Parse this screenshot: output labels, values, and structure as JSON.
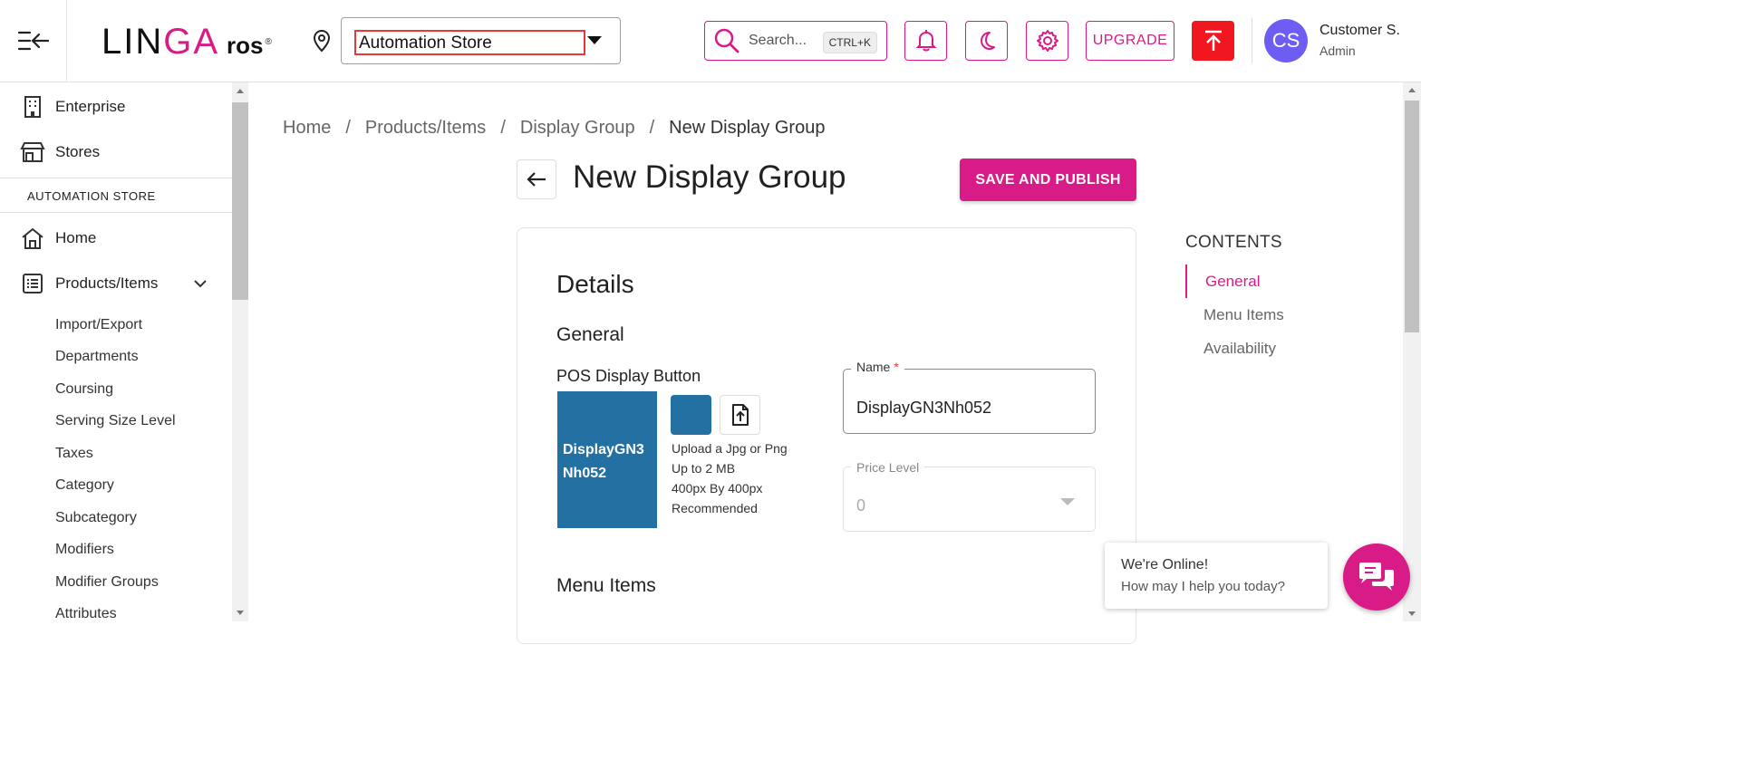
{
  "header": {
    "logo_linga_part1": "LIN",
    "logo_linga_part2": "GA",
    "logo_ros": "ros",
    "logo_reg": "®",
    "store_selected": "Automation Store",
    "search_placeholder": "Search...",
    "search_shortcut": "CTRL+K",
    "upgrade_label": "UPGRADE",
    "user_initials": "CS",
    "user_name": "Customer S.",
    "user_role": "Admin",
    "accent_color": "#d81b87"
  },
  "sidebar": {
    "top_items": [
      {
        "label": "Enterprise",
        "icon": "building-icon"
      },
      {
        "label": "Stores",
        "icon": "store-icon"
      }
    ],
    "section_title": "AUTOMATION STORE",
    "items": [
      {
        "label": "Home",
        "icon": "home-icon"
      },
      {
        "label": "Products/Items",
        "icon": "list-icon"
      }
    ],
    "sub_items": [
      "Import/Export",
      "Departments",
      "Coursing",
      "Serving Size Level",
      "Taxes",
      "Category",
      "Subcategory",
      "Modifiers",
      "Modifier Groups",
      "Attributes"
    ]
  },
  "breadcrumb": {
    "items": [
      "Home",
      "Products/Items",
      "Display Group",
      "New Display Group"
    ],
    "separator": "/"
  },
  "page": {
    "title": "New Display Group",
    "save_label": "SAVE AND PUBLISH"
  },
  "details": {
    "heading": "Details",
    "general_heading": "General",
    "pos_label": "POS Display Button",
    "pos_tile_text": "DisplayGN3Nh052",
    "tile_color": "#2370a3",
    "hint_lines": [
      "Upload a Jpg or Png",
      "Up to 2 MB",
      "400px By 400px",
      "Recommended"
    ],
    "name_label": "Name",
    "name_required": "*",
    "name_value": "DisplayGN3Nh052",
    "price_label": "Price Level",
    "price_value": "0",
    "menu_items_heading": "Menu Items"
  },
  "contents": {
    "title": "CONTENTS",
    "items": [
      "General",
      "Menu Items",
      "Availability"
    ],
    "active": "General"
  },
  "chat": {
    "line1": "We're Online!",
    "line2": "How may I help you today?"
  }
}
